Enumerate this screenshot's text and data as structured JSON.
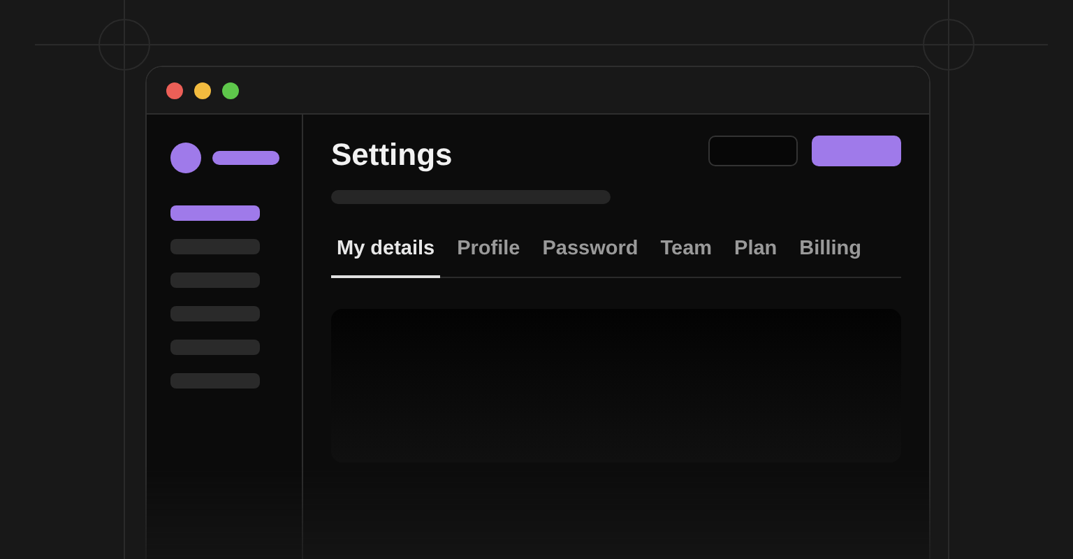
{
  "window": {
    "title": "Settings"
  },
  "sidebar": {
    "items": [
      {
        "selected": true
      },
      {
        "selected": false
      },
      {
        "selected": false
      },
      {
        "selected": false
      },
      {
        "selected": false
      },
      {
        "selected": false
      }
    ]
  },
  "tabs": [
    {
      "label": "My details",
      "selected": true
    },
    {
      "label": "Profile",
      "selected": false
    },
    {
      "label": "Password",
      "selected": false
    },
    {
      "label": "Team",
      "selected": false
    },
    {
      "label": "Plan",
      "selected": false
    },
    {
      "label": "Billing",
      "selected": false
    }
  ]
}
